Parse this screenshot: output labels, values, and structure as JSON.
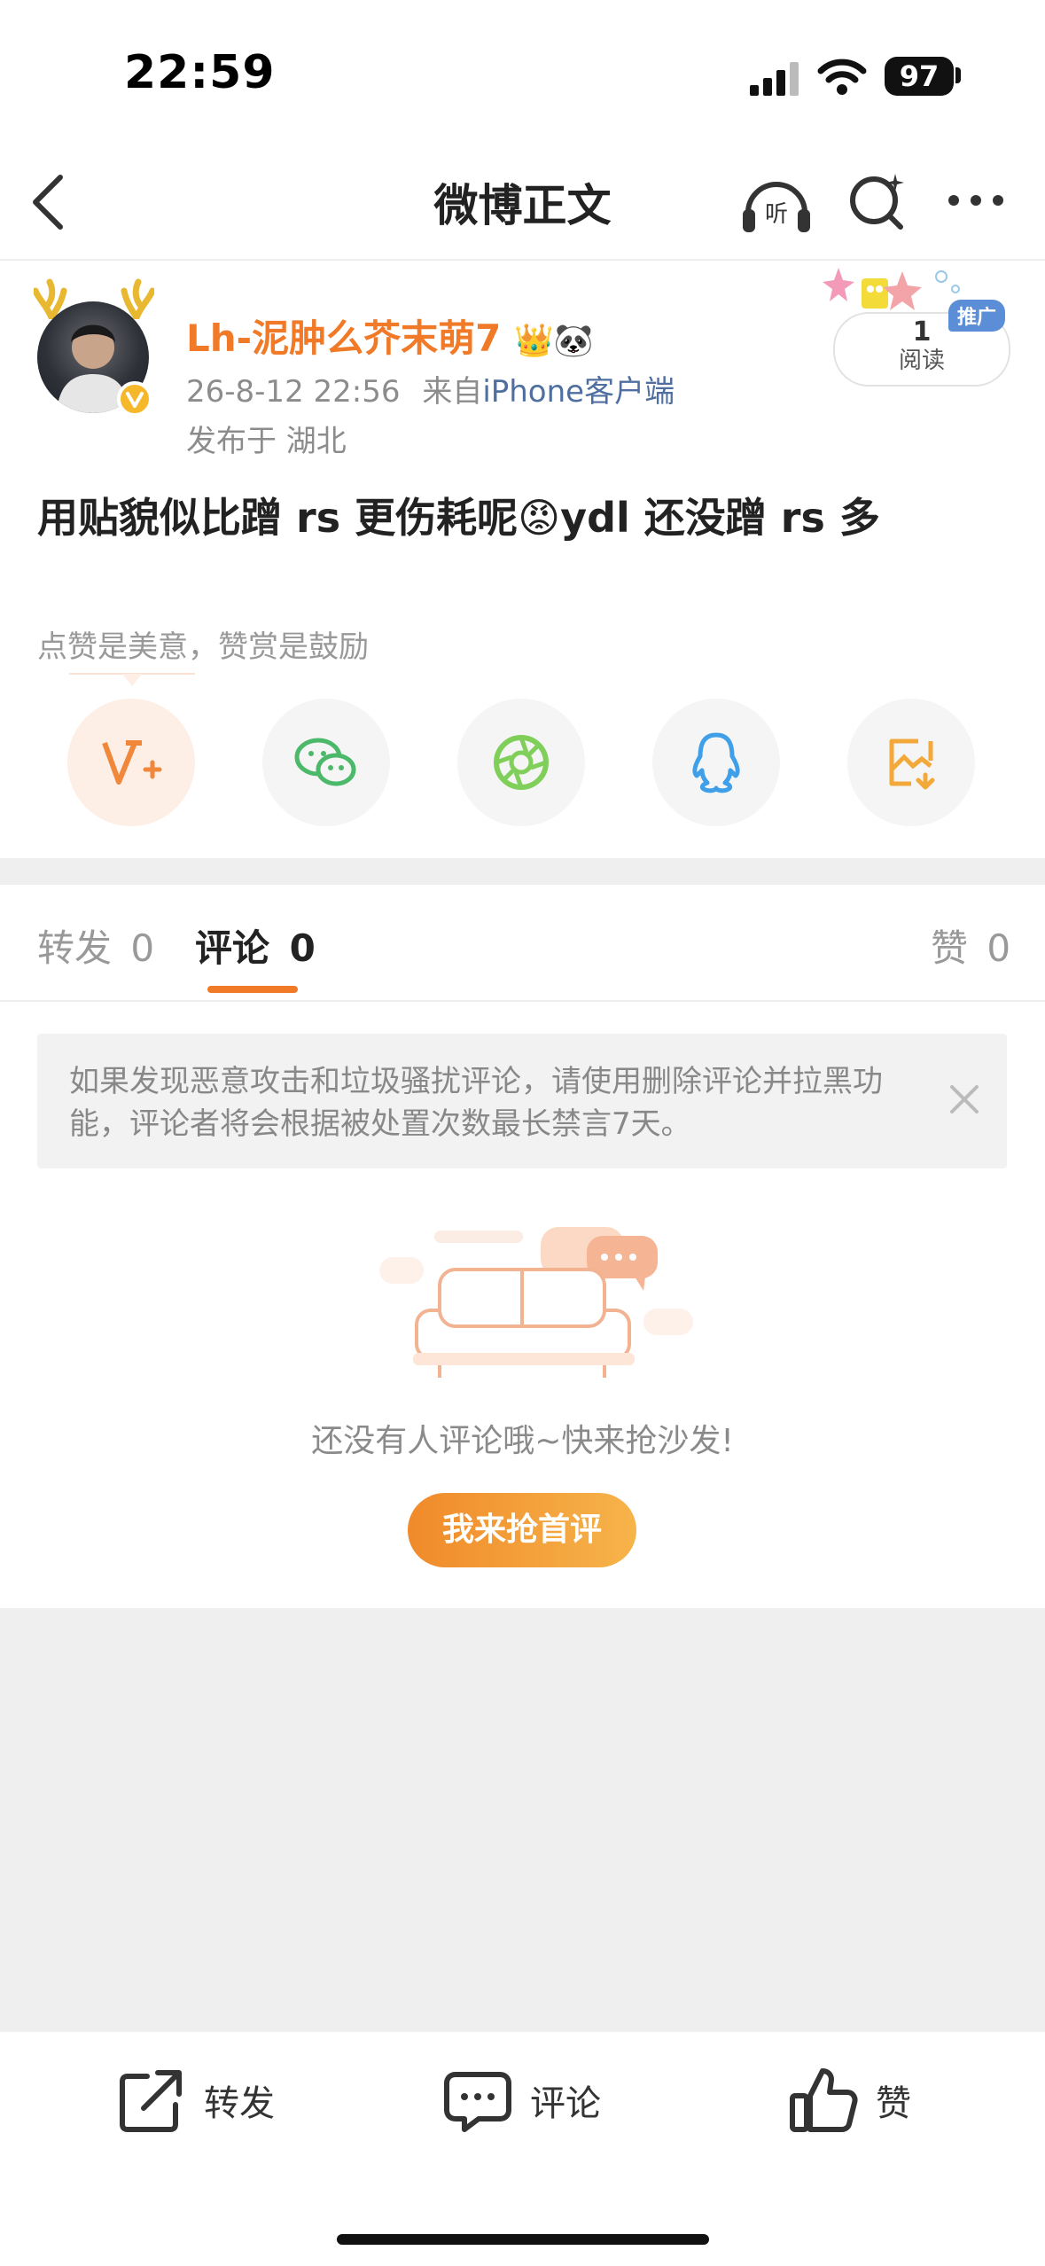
{
  "status_bar": {
    "time": "22:59",
    "battery": "97"
  },
  "nav": {
    "title": "微博正文"
  },
  "post": {
    "username": "Lh-泥肿么芥末萌7",
    "username_emojis": "👑🐼",
    "timestamp": "26-8-12 22:56",
    "source_prefix": "来自",
    "source": "iPhone客户端",
    "location": "发布于 湖北",
    "read_count": "1",
    "read_label": "阅读",
    "promo_tag": "推广",
    "content_part1": "用贴貌似比蹭 rs 更伤耗呢",
    "content_emoji": "😡",
    "content_part2": "ydl 还没蹭 rs 多"
  },
  "reward_hint": "点赞是美意，赞赏是鼓励",
  "share_icons": [
    "v-plus-reward-icon",
    "wechat-icon",
    "moments-icon",
    "qq-icon",
    "save-image-icon"
  ],
  "tabs": {
    "repost_label": "转发",
    "repost_count": "0",
    "comment_label": "评论",
    "comment_count": "0",
    "like_label": "赞",
    "like_count": "0"
  },
  "notice": {
    "text": "如果发现恶意攻击和垃圾骚扰评论，请使用删除评论并拉黑功能，评论者将会根据被处置次数最长禁言7天。"
  },
  "empty_state": {
    "text": "还没有人评论哦~快来抢沙发!",
    "cta": "我来抢首评"
  },
  "bottom_bar": {
    "repost": "转发",
    "comment": "评论",
    "like": "赞"
  },
  "colors": {
    "accent": "#f07a27",
    "source_link": "#4f6fa0",
    "promo": "#5b8ed6"
  }
}
